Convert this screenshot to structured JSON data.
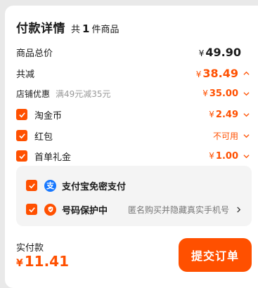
{
  "header": {
    "title": "付款详情",
    "count_prefix": "共",
    "count": "1",
    "count_suffix": "件商品"
  },
  "rows": {
    "total": {
      "label": "商品总价",
      "currency": "¥",
      "amount": "49.90"
    },
    "reduce": {
      "label": "共减",
      "currency": "¥",
      "amount": "38.49"
    },
    "store": {
      "label": "店铺优惠",
      "note": "满49元减35元",
      "currency": "¥",
      "amount": "35.00"
    },
    "coin": {
      "label": "淘金币",
      "currency": "¥",
      "amount": "2.49"
    },
    "redpacket": {
      "label": "红包",
      "status": "不可用"
    },
    "gift": {
      "label": "首单礼金",
      "currency": "¥",
      "amount": "1.00"
    }
  },
  "options": {
    "alipay": {
      "label": "支付宝免密支付",
      "icon": "alipay-icon"
    },
    "privacy": {
      "label": "号码保护中",
      "note": "匿名购买并隐藏真实手机号",
      "icon": "shield-icon"
    }
  },
  "footer": {
    "label": "实付款",
    "currency": "¥",
    "amount": "11.41",
    "submit_label": "提交订单"
  },
  "colors": {
    "accent": "#ff5000",
    "alipay": "#1677ff",
    "shield": "#ff5000",
    "background": "#e9e9e9"
  }
}
